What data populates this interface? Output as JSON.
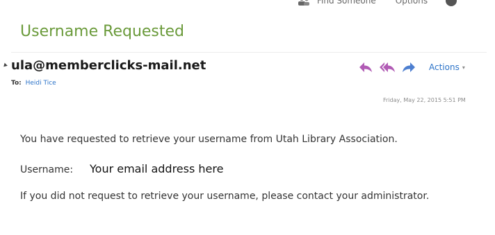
{
  "top_bar": {
    "find_label": "Find Someone",
    "options_label": "Options"
  },
  "email": {
    "subject": "Username Requested",
    "sender": "ula@memberclicks-mail.net",
    "to_label": "To:",
    "to_name": "Heidi Tice",
    "date": "Friday, May 22, 2015 5:51 PM",
    "actions_label": "Actions",
    "body": {
      "line1": "You have requested to retrieve your username from Utah Library Association.",
      "username_label": "Username:",
      "username_value": "Your email address here",
      "line3": "If you did not request to retrieve your username, please contact your administrator."
    }
  },
  "icons": {
    "reply": "reply-icon",
    "reply_all": "reply-all-icon",
    "forward": "forward-icon",
    "people": "people-icon",
    "help": "help-icon",
    "collapse": "collapse-arrow-icon"
  },
  "colors": {
    "subject": "#6a9a3a",
    "link": "#2a72c8",
    "reply_icon": "#b15bb5",
    "forward_icon": "#4d7fd0"
  }
}
